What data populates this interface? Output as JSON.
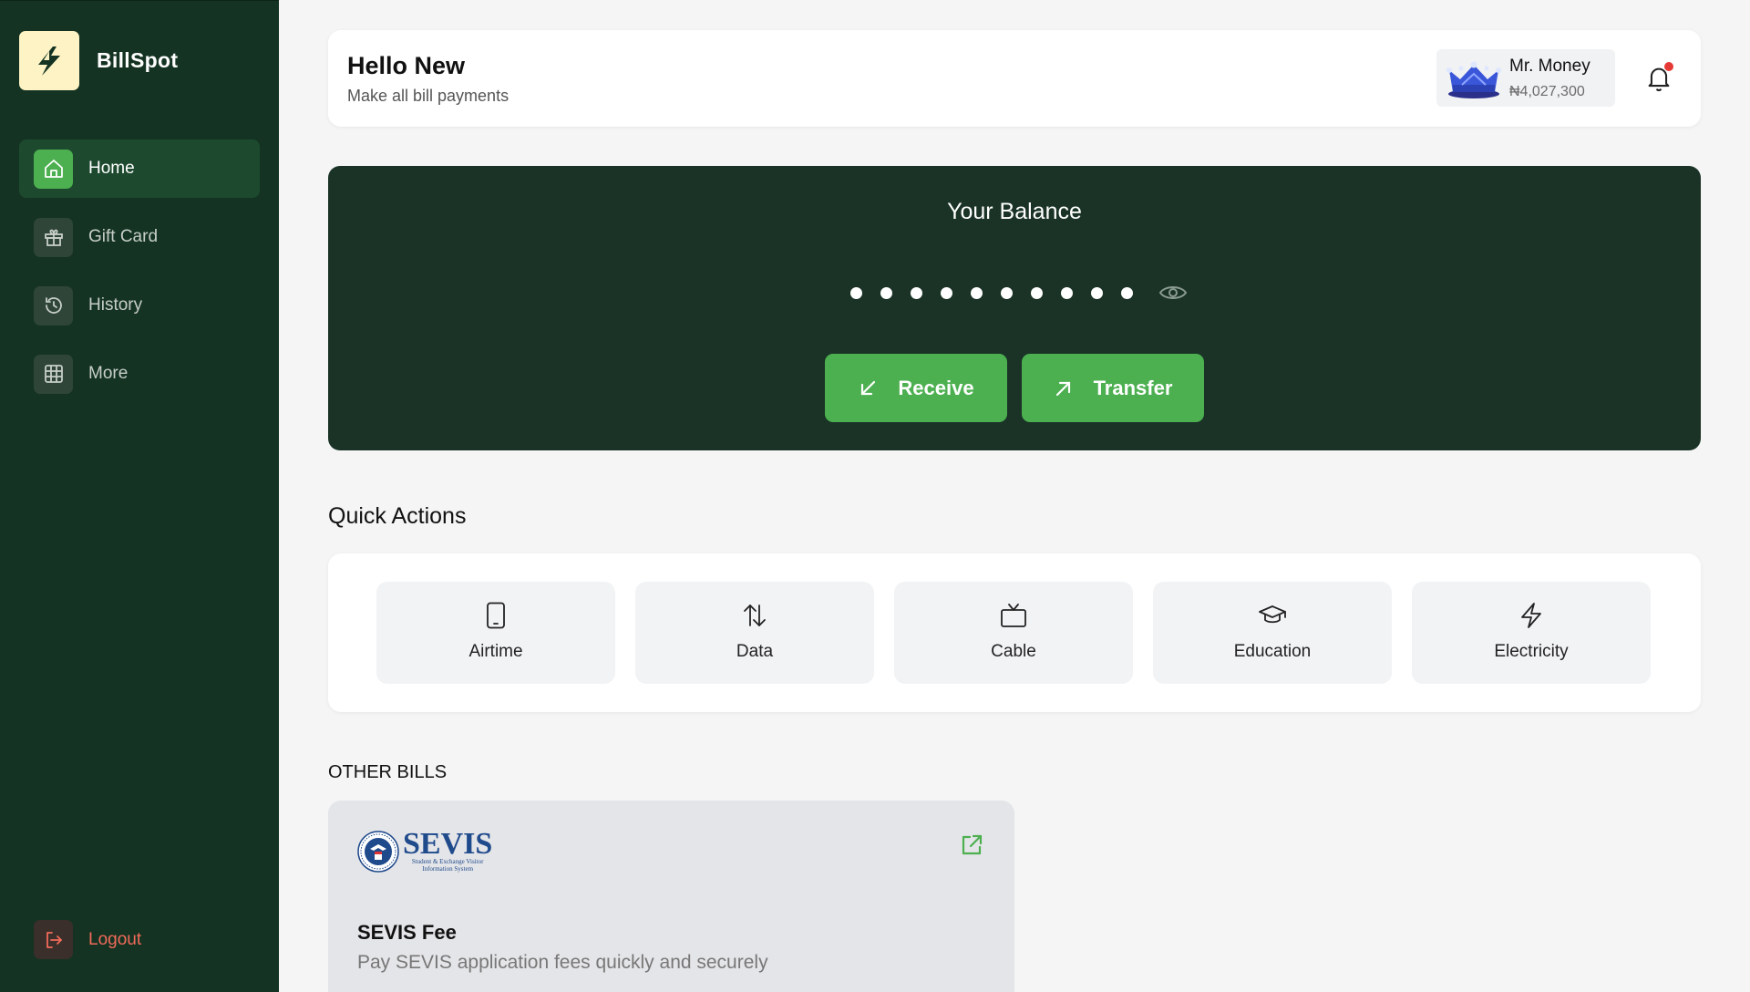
{
  "brand": {
    "name": "BillSpot"
  },
  "sidebar": {
    "items": [
      {
        "label": "Home",
        "icon": "home-icon",
        "active": true
      },
      {
        "label": "Gift Card",
        "icon": "gift-icon",
        "active": false
      },
      {
        "label": "History",
        "icon": "history-icon",
        "active": false
      },
      {
        "label": "More",
        "icon": "grid-icon",
        "active": false
      }
    ],
    "logout_label": "Logout"
  },
  "header": {
    "greeting": "Hello New",
    "subtitle": "Make all bill payments",
    "user": {
      "name": "Mr. Money",
      "balance": "₦4,027,300"
    }
  },
  "balance": {
    "title": "Your Balance",
    "masked_dots": 10,
    "receive_label": "Receive",
    "transfer_label": "Transfer"
  },
  "quick_actions": {
    "title": "Quick Actions",
    "items": [
      {
        "label": "Airtime",
        "icon": "phone-icon"
      },
      {
        "label": "Data",
        "icon": "arrows-up-down-icon"
      },
      {
        "label": "Cable",
        "icon": "tv-icon"
      },
      {
        "label": "Education",
        "icon": "graduation-cap-icon"
      },
      {
        "label": "Electricity",
        "icon": "lightning-icon"
      }
    ]
  },
  "other_bills": {
    "title": "OTHER BILLS",
    "items": [
      {
        "logo_word": "SEVIS",
        "logo_tagline_1": "Student & Exchange Visitor",
        "logo_tagline_2": "Information System",
        "name": "SEVIS Fee",
        "description": "Pay SEVIS application fees quickly and securely"
      }
    ]
  },
  "colors": {
    "sidebar_bg": "#143322",
    "accent_green": "#4caf50",
    "balance_bg": "#1a3326",
    "logout_red": "#f26b5a",
    "notification_red": "#e53935"
  }
}
